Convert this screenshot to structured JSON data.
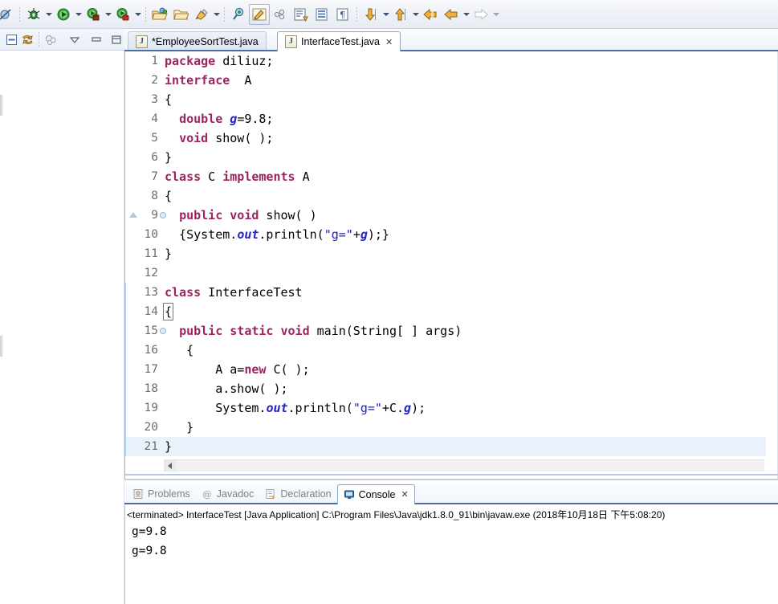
{
  "toolbar": {
    "groups": [
      {
        "name": "debug-group",
        "items": [
          {
            "name": "skip-breakpoints-icon",
            "label": "Skip All Breakpoints",
            "dropdown": false
          },
          {
            "name": "debug-icon",
            "label": "Debug",
            "dropdown": true
          },
          {
            "name": "run-icon",
            "label": "Run",
            "dropdown": true
          },
          {
            "name": "run-external-tools-icon",
            "label": "External Tools",
            "dropdown": true
          },
          {
            "name": "run-coverage-icon",
            "label": "Coverage",
            "dropdown": true
          }
        ]
      },
      {
        "name": "open-group",
        "items": [
          {
            "name": "new-java-package-icon",
            "label": "New Java Package",
            "dropdown": false
          },
          {
            "name": "open-type-icon",
            "label": "Open Type",
            "dropdown": false
          },
          {
            "name": "open-task-icon",
            "label": "Open Task",
            "dropdown": true
          }
        ]
      },
      {
        "name": "search-group",
        "items": [
          {
            "name": "search-icon",
            "label": "Search",
            "dropdown": false
          },
          {
            "name": "pencil-edit-icon",
            "label": "Toggle Mark Occurrences",
            "dropdown": false,
            "pressed": true
          },
          {
            "name": "link-icon",
            "label": "Link",
            "dropdown": false
          },
          {
            "name": "new-java-class-icon",
            "label": "New Java Class",
            "dropdown": false
          },
          {
            "name": "new-annotation-icon",
            "label": "New Annotation",
            "dropdown": false
          },
          {
            "name": "paragraph-icon",
            "label": "Show Whitespace Characters",
            "dropdown": false
          }
        ]
      },
      {
        "name": "annotation-nav-group",
        "items": [
          {
            "name": "next-annotation-icon",
            "label": "Next Annotation",
            "dropdown": true
          },
          {
            "name": "previous-annotation-icon",
            "label": "Previous Annotation",
            "dropdown": true
          }
        ]
      },
      {
        "name": "history-nav-group",
        "items": [
          {
            "name": "last-edit-location-icon",
            "label": "Last Edit Location",
            "dropdown": false
          },
          {
            "name": "back-icon",
            "label": "Back",
            "dropdown": true
          },
          {
            "name": "forward-icon",
            "label": "Forward",
            "dropdown": true
          }
        ]
      }
    ]
  },
  "left_panel": {
    "toolbar_items": [
      {
        "name": "collapse-all-icon",
        "label": "Collapse All"
      },
      {
        "name": "link-with-editor-icon",
        "label": "Link with Editor"
      },
      {
        "name": "focus-on-active-task-icon",
        "label": "Focus on Active Task"
      },
      {
        "name": "view-menu-icon",
        "label": "View Menu"
      },
      {
        "name": "minimize-view-icon",
        "label": "Minimize"
      },
      {
        "name": "maximize-view-icon",
        "label": "Maximize"
      }
    ]
  },
  "editor": {
    "tabs": [
      {
        "name": "tab-employee-sort-test",
        "label": "*EmployeeSortTest.java",
        "active": false,
        "closable": false
      },
      {
        "name": "tab-interface-test",
        "label": "InterfaceTest.java",
        "active": true,
        "closable": true
      }
    ],
    "close_glyph": "✕",
    "java_file_glyph": "J",
    "current_line": 21,
    "lines": [
      {
        "n": 1,
        "fold": false,
        "marker": false,
        "changed": false,
        "segments": [
          {
            "t": "package",
            "c": "kw"
          },
          {
            "t": " diliuz;",
            "c": ""
          }
        ]
      },
      {
        "n": 2,
        "fold": false,
        "marker": false,
        "changed": false,
        "segments": [
          {
            "t": "interface",
            "c": "kw"
          },
          {
            "t": "  A",
            "c": ""
          }
        ]
      },
      {
        "n": 3,
        "fold": false,
        "marker": false,
        "changed": false,
        "segments": [
          {
            "t": "{",
            "c": ""
          }
        ]
      },
      {
        "n": 4,
        "fold": false,
        "marker": false,
        "changed": false,
        "segments": [
          {
            "t": "  ",
            "c": ""
          },
          {
            "t": "double",
            "c": "kw"
          },
          {
            "t": " ",
            "c": ""
          },
          {
            "t": "g",
            "c": "fld"
          },
          {
            "t": "=9.8;",
            "c": ""
          }
        ]
      },
      {
        "n": 5,
        "fold": false,
        "marker": false,
        "changed": false,
        "segments": [
          {
            "t": "  ",
            "c": ""
          },
          {
            "t": "void",
            "c": "kw"
          },
          {
            "t": " show( );",
            "c": ""
          }
        ]
      },
      {
        "n": 6,
        "fold": false,
        "marker": false,
        "changed": false,
        "segments": [
          {
            "t": "}",
            "c": ""
          }
        ]
      },
      {
        "n": 7,
        "fold": false,
        "marker": false,
        "changed": false,
        "segments": [
          {
            "t": "class",
            "c": "kw"
          },
          {
            "t": " C ",
            "c": ""
          },
          {
            "t": "implements",
            "c": "kw"
          },
          {
            "t": " A",
            "c": ""
          }
        ]
      },
      {
        "n": 8,
        "fold": false,
        "marker": false,
        "changed": false,
        "segments": [
          {
            "t": "{",
            "c": ""
          }
        ]
      },
      {
        "n": 9,
        "fold": true,
        "marker": true,
        "changed": false,
        "segments": [
          {
            "t": "  ",
            "c": ""
          },
          {
            "t": "public",
            "c": "kw"
          },
          {
            "t": " ",
            "c": ""
          },
          {
            "t": "void",
            "c": "kw"
          },
          {
            "t": " show( )",
            "c": ""
          }
        ]
      },
      {
        "n": 10,
        "fold": false,
        "marker": false,
        "changed": false,
        "segments": [
          {
            "t": "  {System.",
            "c": ""
          },
          {
            "t": "out",
            "c": "fld"
          },
          {
            "t": ".println(",
            "c": ""
          },
          {
            "t": "\"g=\"",
            "c": "str"
          },
          {
            "t": "+",
            "c": ""
          },
          {
            "t": "g",
            "c": "fld"
          },
          {
            "t": ");}",
            "c": ""
          }
        ]
      },
      {
        "n": 11,
        "fold": false,
        "marker": false,
        "changed": false,
        "segments": [
          {
            "t": "}",
            "c": ""
          }
        ]
      },
      {
        "n": 12,
        "fold": false,
        "marker": false,
        "changed": false,
        "segments": [
          {
            "t": "",
            "c": ""
          }
        ]
      },
      {
        "n": 13,
        "fold": false,
        "marker": false,
        "changed": true,
        "segments": [
          {
            "t": "class",
            "c": "kw"
          },
          {
            "t": " InterfaceTest",
            "c": ""
          }
        ]
      },
      {
        "n": 14,
        "fold": false,
        "marker": false,
        "changed": true,
        "segments": [
          {
            "t": "{",
            "c": "brkt"
          }
        ]
      },
      {
        "n": 15,
        "fold": true,
        "marker": false,
        "changed": true,
        "segments": [
          {
            "t": "  ",
            "c": ""
          },
          {
            "t": "public",
            "c": "kw"
          },
          {
            "t": " ",
            "c": ""
          },
          {
            "t": "static",
            "c": "kw"
          },
          {
            "t": " ",
            "c": ""
          },
          {
            "t": "void",
            "c": "kw"
          },
          {
            "t": " main(String[ ] args)",
            "c": ""
          }
        ]
      },
      {
        "n": 16,
        "fold": false,
        "marker": false,
        "changed": true,
        "segments": [
          {
            "t": "   {",
            "c": ""
          }
        ]
      },
      {
        "n": 17,
        "fold": false,
        "marker": false,
        "changed": true,
        "segments": [
          {
            "t": "       A a=",
            "c": ""
          },
          {
            "t": "new",
            "c": "kw"
          },
          {
            "t": " C( );",
            "c": ""
          }
        ]
      },
      {
        "n": 18,
        "fold": false,
        "marker": false,
        "changed": true,
        "segments": [
          {
            "t": "       a.show( );",
            "c": ""
          }
        ]
      },
      {
        "n": 19,
        "fold": false,
        "marker": false,
        "changed": true,
        "segments": [
          {
            "t": "       System.",
            "c": ""
          },
          {
            "t": "out",
            "c": "fld"
          },
          {
            "t": ".println(",
            "c": ""
          },
          {
            "t": "\"g=\"",
            "c": "str"
          },
          {
            "t": "+C.",
            "c": ""
          },
          {
            "t": "g",
            "c": "fld"
          },
          {
            "t": ");",
            "c": ""
          }
        ]
      },
      {
        "n": 20,
        "fold": false,
        "marker": false,
        "changed": true,
        "segments": [
          {
            "t": "   }",
            "c": ""
          }
        ]
      },
      {
        "n": 21,
        "fold": false,
        "marker": false,
        "changed": true,
        "segments": [
          {
            "t": "}",
            "c": ""
          }
        ]
      }
    ]
  },
  "bottom_view": {
    "tabs": [
      {
        "name": "tab-problems",
        "label": "Problems",
        "icon": "problems-icon",
        "active": false,
        "closable": false
      },
      {
        "name": "tab-javadoc",
        "label": "Javadoc",
        "icon": "javadoc-icon",
        "active": false,
        "closable": false
      },
      {
        "name": "tab-declaration",
        "label": "Declaration",
        "icon": "declaration-icon",
        "active": false,
        "closable": false
      },
      {
        "name": "tab-console",
        "label": "Console",
        "icon": "console-icon",
        "active": true,
        "closable": true
      }
    ],
    "close_glyph": "✕",
    "console": {
      "header": "<terminated> InterfaceTest [Java Application] C:\\Program Files\\Java\\jdk1.8.0_91\\bin\\javaw.exe (2018年10月18日 下午5:08:20)",
      "output_lines": [
        "g=9.8",
        "g=9.8"
      ]
    }
  },
  "colors": {
    "keyword": "#9c2561",
    "field": "#2323c8",
    "string": "#2020c0",
    "tab_underline": "#4a6fa5",
    "current_line": "#eaf1fb",
    "change_bar": "#8cb4d8"
  }
}
